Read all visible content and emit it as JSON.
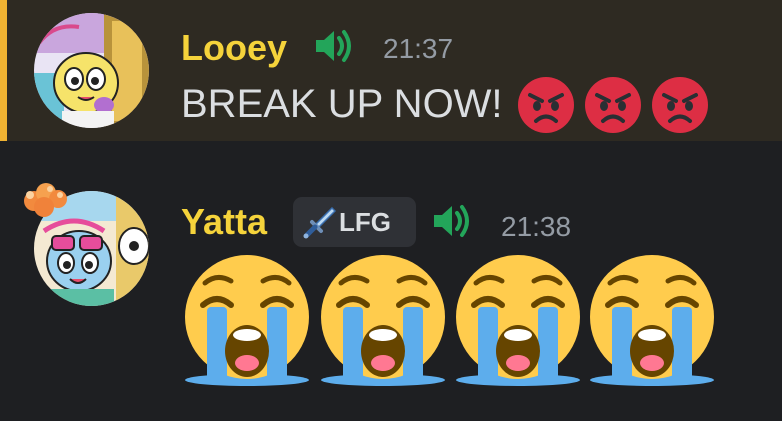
{
  "messages": [
    {
      "username": "Looey",
      "username_color": "#f5d33b",
      "voice_icon": "speaker-icon",
      "timestamp": "21:37",
      "text": "BREAK UP NOW!",
      "reactions_inline": [
        "angry-face-emoji",
        "angry-face-emoji",
        "angry-face-emoji"
      ],
      "highlighted": true,
      "highlight_color": "#f0b232"
    },
    {
      "username": "Yatta",
      "username_color": "#f5d33b",
      "tag": {
        "icon": "sword-icon",
        "label": "LFG"
      },
      "voice_icon": "speaker-icon",
      "timestamp": "21:38",
      "emojis": [
        "loudly-crying-face-emoji",
        "loudly-crying-face-emoji",
        "loudly-crying-face-emoji",
        "loudly-crying-face-emoji"
      ]
    }
  ],
  "colors": {
    "background": "#1e1f22",
    "highlight_background": "#2e2a22",
    "text": "#dbdee1",
    "muted": "#949ba4",
    "voice_green": "#23a55a"
  }
}
